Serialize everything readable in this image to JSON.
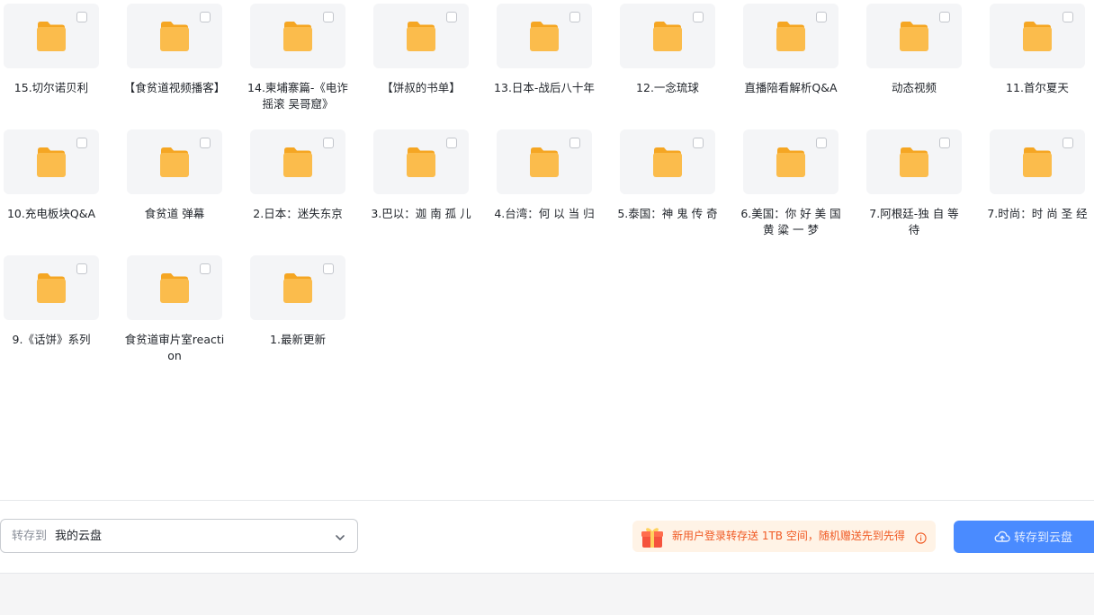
{
  "folders": [
    {
      "name": "15.切尔诺贝利"
    },
    {
      "name": "【食贫道视频播客】"
    },
    {
      "name": "14.柬埔寨篇-《电诈 摇滚 吴哥窟》"
    },
    {
      "name": "【饼叔的书单】"
    },
    {
      "name": "13.日本-战后八十年"
    },
    {
      "name": "12.一念琉球"
    },
    {
      "name": "直播陪看解析Q&A"
    },
    {
      "name": "动态视频"
    },
    {
      "name": "11.首尔夏天"
    },
    {
      "name": "10.充电板块Q&A"
    },
    {
      "name": "食贫道 弹幕"
    },
    {
      "name": "2.日本：迷失东京"
    },
    {
      "name": "3.巴以：迦 南 孤 儿"
    },
    {
      "name": "4.台湾：何 以 当 归"
    },
    {
      "name": "5.泰国：神 鬼 传 奇"
    },
    {
      "name": "6.美国：你 好 美 国 黄 粱 一 梦"
    },
    {
      "name": "7.阿根廷-独 自 等 待"
    },
    {
      "name": "7.时尚：时 尚 圣 经"
    },
    {
      "name": "9.《话饼》系列"
    },
    {
      "name": "食贫道审片室reaction"
    },
    {
      "name": "1.最新更新"
    }
  ],
  "footer": {
    "save_to_label": "转存到",
    "save_to_value": "我的云盘",
    "promo_text": "新用户登录转存送 1TB 空间，随机赠送先到先得",
    "save_button_label": "转存到云盘"
  },
  "colors": {
    "folder": "#fbbc4c",
    "folder_back": "#f5a623",
    "accent": "#4a8bff",
    "promo_text": "#f05a24",
    "promo_bg": "#fff3e6"
  },
  "icons": {
    "folder": "folder-icon",
    "checkbox": "checkbox",
    "chevron": "chevron-down-icon",
    "gift": "gift-icon",
    "info": "info-icon",
    "cloud": "cloud-upload-icon"
  }
}
